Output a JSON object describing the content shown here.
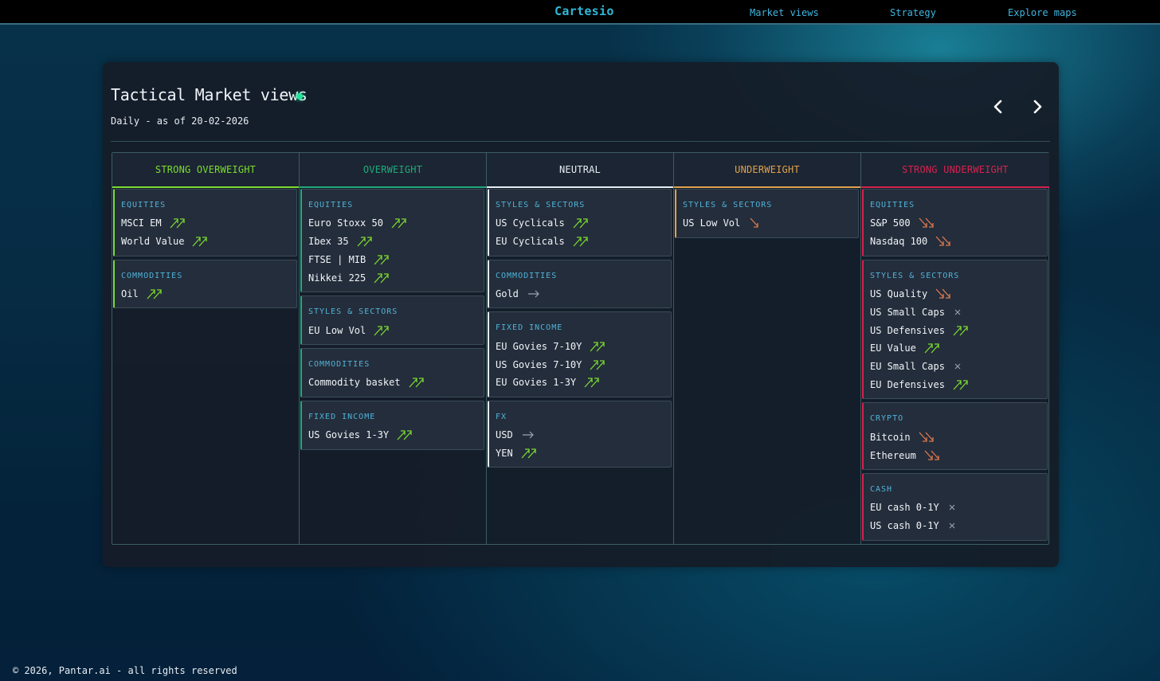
{
  "topbar": {
    "brand": "Cartesio",
    "links": [
      "Market views",
      "Strategy",
      "Explore maps"
    ]
  },
  "panel": {
    "title": "Tactical Market views",
    "subtitle": "Daily - as of 20-02-2026"
  },
  "colors": {
    "strong_overweight": "#7bdc2f",
    "overweight": "#1faa7a",
    "neutral": "#e6edf3",
    "underweight": "#e0a24e",
    "strong_underweight": "#d6214f",
    "up": "#7bdc2f",
    "down": "#e07a4e",
    "flat": "#9aa4ae"
  },
  "columns": [
    {
      "key": "strong_overweight",
      "label": "STRONG OVERWEIGHT",
      "cards": [
        {
          "title": "EQUITIES",
          "items": [
            {
              "label": "MSCI EM",
              "signal": "up2"
            },
            {
              "label": "World Value",
              "signal": "up2"
            }
          ]
        },
        {
          "title": "COMMODITIES",
          "items": [
            {
              "label": "Oil",
              "signal": "up2"
            }
          ]
        }
      ]
    },
    {
      "key": "overweight",
      "label": "OVERWEIGHT",
      "cards": [
        {
          "title": "EQUITIES",
          "items": [
            {
              "label": "Euro Stoxx 50",
              "signal": "up2"
            },
            {
              "label": "Ibex 35",
              "signal": "up2"
            },
            {
              "label": "FTSE | MIB",
              "signal": "up2"
            },
            {
              "label": "Nikkei 225",
              "signal": "up2"
            }
          ]
        },
        {
          "title": "STYLES & SECTORS",
          "items": [
            {
              "label": "EU Low Vol",
              "signal": "up2"
            }
          ]
        },
        {
          "title": "COMMODITIES",
          "items": [
            {
              "label": "Commodity basket",
              "signal": "up2"
            }
          ]
        },
        {
          "title": "FIXED INCOME",
          "items": [
            {
              "label": "US Govies 1-3Y",
              "signal": "up2"
            }
          ]
        }
      ]
    },
    {
      "key": "neutral",
      "label": "NEUTRAL",
      "cards": [
        {
          "title": "STYLES & SECTORS",
          "items": [
            {
              "label": "US Cyclicals",
              "signal": "up2"
            },
            {
              "label": "EU Cyclicals",
              "signal": "up2"
            }
          ]
        },
        {
          "title": "COMMODITIES",
          "items": [
            {
              "label": "Gold",
              "signal": "flat"
            }
          ]
        },
        {
          "title": "FIXED INCOME",
          "items": [
            {
              "label": "EU Govies 7-10Y",
              "signal": "up2"
            },
            {
              "label": "US Govies 7-10Y",
              "signal": "up2"
            },
            {
              "label": "EU Govies 1-3Y",
              "signal": "up2"
            }
          ]
        },
        {
          "title": "FX",
          "items": [
            {
              "label": "USD",
              "signal": "flat"
            },
            {
              "label": "YEN",
              "signal": "up2"
            }
          ]
        }
      ]
    },
    {
      "key": "underweight",
      "label": "UNDERWEIGHT",
      "cards": [
        {
          "title": "STYLES & SECTORS",
          "items": [
            {
              "label": "US Low Vol",
              "signal": "down1"
            }
          ]
        }
      ]
    },
    {
      "key": "strong_underweight",
      "label": "STRONG UNDERWEIGHT",
      "cards": [
        {
          "title": "EQUITIES",
          "items": [
            {
              "label": "S&P 500",
              "signal": "down2"
            },
            {
              "label": "Nasdaq 100",
              "signal": "down2"
            }
          ]
        },
        {
          "title": "STYLES & SECTORS",
          "items": [
            {
              "label": "US Quality",
              "signal": "down2"
            },
            {
              "label": "US Small Caps",
              "signal": "x"
            },
            {
              "label": "US Defensives",
              "signal": "up2"
            },
            {
              "label": "EU Value",
              "signal": "up2"
            },
            {
              "label": "EU Small Caps",
              "signal": "x"
            },
            {
              "label": "EU Defensives",
              "signal": "up2"
            }
          ]
        },
        {
          "title": "CRYPTO",
          "items": [
            {
              "label": "Bitcoin",
              "signal": "down2"
            },
            {
              "label": "Ethereum",
              "signal": "down2"
            }
          ]
        },
        {
          "title": "CASH",
          "items": [
            {
              "label": "EU cash 0-1Y",
              "signal": "x"
            },
            {
              "label": "US cash 0-1Y",
              "signal": "x"
            }
          ]
        }
      ]
    }
  ],
  "footer": "© 2026, Pantar.ai - all rights reserved"
}
